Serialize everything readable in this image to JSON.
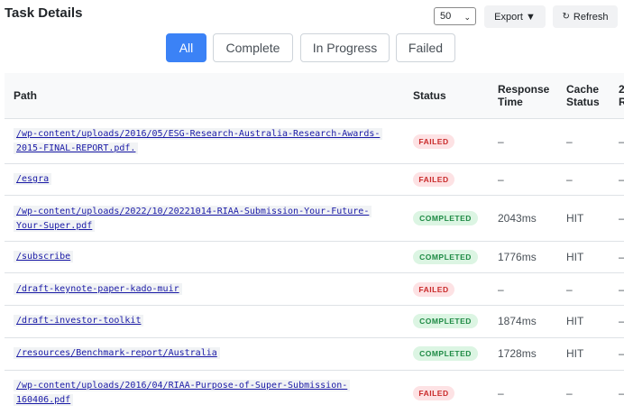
{
  "header": {
    "title": "Task Details",
    "page_size": "50",
    "export_label": "Export ▼",
    "refresh_label": "Refresh"
  },
  "filters": [
    "All",
    "Complete",
    "In Progress",
    "Failed"
  ],
  "active_filter": "All",
  "table": {
    "columns": {
      "path": "Path",
      "status": "Status",
      "response_time": "Response Time",
      "cache_status": "Cache Status",
      "extra": "2 R"
    },
    "rows": [
      {
        "path": "/wp-content/uploads/2016/05/ESG-Research-Australia-Research-Awards-2015-FINAL-REPORT.pdf.",
        "status": "FAILED",
        "response_time": "–",
        "cache": "–",
        "extra": "–"
      },
      {
        "path": "/esgra",
        "status": "FAILED",
        "response_time": "–",
        "cache": "–",
        "extra": "–"
      },
      {
        "path": "/wp-content/uploads/2022/10/20221014-RIAA-Submission-Your-Future-Your-Super.pdf",
        "status": "COMPLETED",
        "response_time": "2043ms",
        "cache": "HIT",
        "extra": "–"
      },
      {
        "path": "/subscribe",
        "status": "COMPLETED",
        "response_time": "1776ms",
        "cache": "HIT",
        "extra": "–"
      },
      {
        "path": "/draft-keynote-paper-kado-muir",
        "status": "FAILED",
        "response_time": "–",
        "cache": "–",
        "extra": "–"
      },
      {
        "path": "/draft-investor-toolkit",
        "status": "COMPLETED",
        "response_time": "1874ms",
        "cache": "HIT",
        "extra": "–"
      },
      {
        "path": "/resources/Benchmark-report/Australia",
        "status": "COMPLETED",
        "response_time": "1728ms",
        "cache": "HIT",
        "extra": "–"
      },
      {
        "path": "/wp-content/uploads/2016/04/RIAA-Purpose-of-Super-Submission-160406.pdf",
        "status": "FAILED",
        "response_time": "–",
        "cache": "–",
        "extra": "–"
      }
    ]
  }
}
